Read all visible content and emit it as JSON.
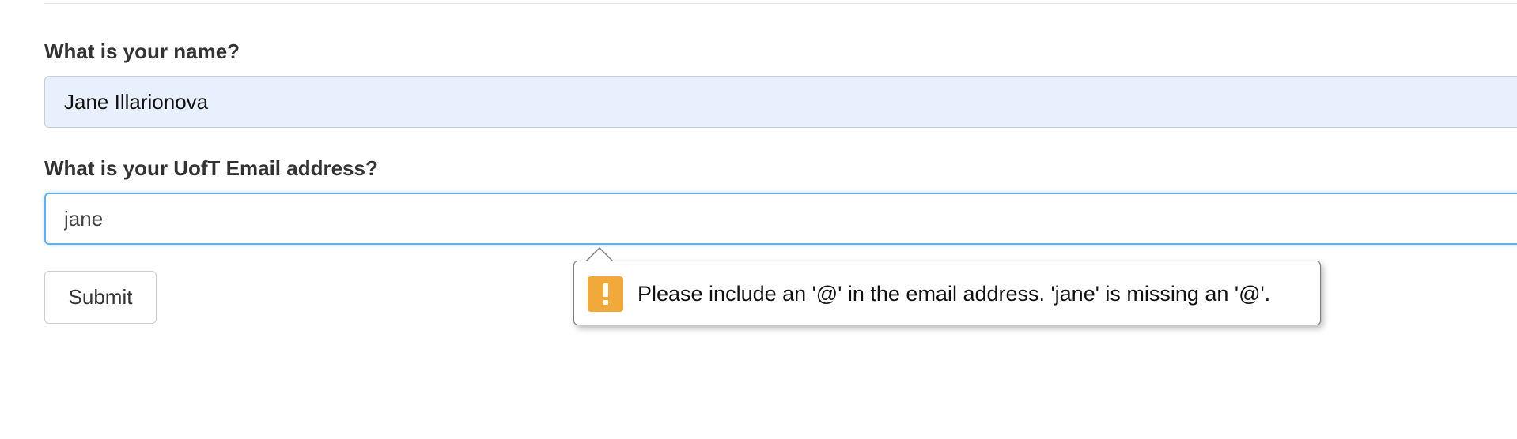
{
  "form": {
    "name_label": "What is your name?",
    "name_value": "Jane Illarionova",
    "email_label": "What is your UofT Email address?",
    "email_value": "jane",
    "submit_label": "Submit"
  },
  "validation": {
    "icon": "warning-icon",
    "message": "Please include an '@' in the email address. 'jane' is missing an '@'."
  },
  "colors": {
    "autofill_background": "#e8f0fe",
    "focus_border": "#66afe9",
    "warning_icon": "#f2a93b"
  }
}
